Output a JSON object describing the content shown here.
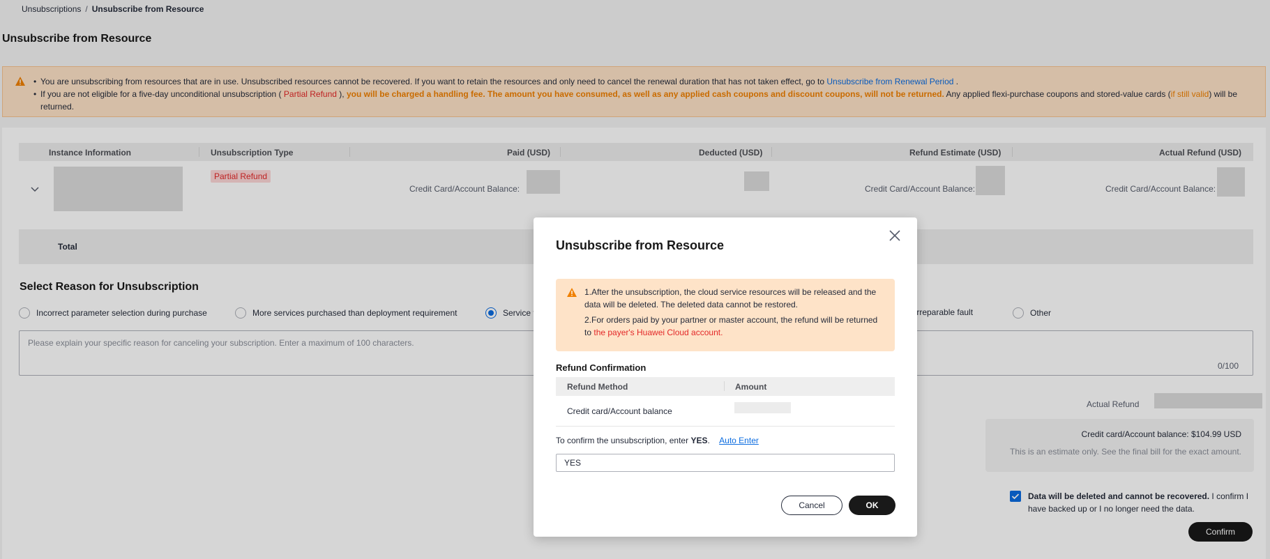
{
  "breadcrumb": {
    "parent": "Unsubscriptions",
    "current": "Unsubscribe from Resource"
  },
  "page_title": "Unsubscribe from Resource",
  "alert": {
    "line1_text": "You are unsubscribing from resources that are in use. Unsubscribed resources cannot be recovered. If you want to retain the resources and only need to cancel the renewal duration that has not taken effect, go to",
    "line1_link": "Unsubscribe from Renewal Period",
    "line1_end": ".",
    "line2_a": "If you are not eligible for a five-day unconditional unsubscription (",
    "line2_partial": "Partial Refund",
    "line2_b": "),",
    "line2_warning": "you will be charged a handling fee. The amount you have consumed, as well as any applied cash coupons and discount coupons, will not be returned.",
    "line2_c": "Any applied flexi-purchase coupons and stored-value cards (",
    "line2_valid": "if still valid",
    "line2_d": ") will be returned."
  },
  "table": {
    "headers": [
      "Instance Information",
      "Unsubscription Type",
      "Paid (USD)",
      "Deducted (USD)",
      "Refund Estimate (USD)",
      "Actual Refund (USD)"
    ],
    "row": {
      "type_badge": "Partial Refund",
      "paid_label": "Credit Card/Account Balance:",
      "refund_label": "Credit Card/Account Balance:",
      "actual_label": "Credit Card/Account Balance:"
    },
    "total_label": "Total"
  },
  "reason": {
    "title": "Select Reason for Unsubscription",
    "options": [
      "Incorrect parameter selection during purchase",
      "More services purchased than deployment requirement",
      "Service t",
      "Irreparable fault",
      "Other"
    ],
    "selected_index": 2,
    "placeholder": "Please explain your specific reason for canceling your subscription. Enter a maximum of 100 characters.",
    "counter": "0/100"
  },
  "refund_summary": {
    "actual_refund_label": "Actual Refund",
    "tip_line1": "Credit card/Account balance: $104.99 USD",
    "tip_line2": "This is an estimate only. See the final bill for the exact amount."
  },
  "agreement": {
    "checked": true,
    "bold_text": "Data will be deleted and cannot be recovered.",
    "rest_text": "I confirm I have backed up or I no longer need the data."
  },
  "confirm_button": "Confirm",
  "modal": {
    "title": "Unsubscribe from Resource",
    "warning_1": "1.After the unsubscription, the cloud service resources will be released and the data will be deleted. The deleted data cannot be restored.",
    "warning_2_a": "2.For orders paid by your partner or master account, the refund will be returned to",
    "warning_2_red": "the payer's Huawei Cloud account.",
    "section_title": "Refund Confirmation",
    "table_headers": [
      "Refund Method",
      "Amount"
    ],
    "table_row_method": "Credit card/Account balance",
    "confirm_hint_a": "To confirm the unsubscription, enter",
    "confirm_hint_keyword": "YES",
    "confirm_hint_end": ".",
    "auto_enter": "Auto Enter",
    "input_value": "YES",
    "cancel_label": "Cancel",
    "ok_label": "OK"
  },
  "colors": {
    "accent": "#0b6ce0",
    "warning_bg": "#fee3c8",
    "danger": "#e32828",
    "orange": "#f08000",
    "primary_button": "#191919"
  }
}
